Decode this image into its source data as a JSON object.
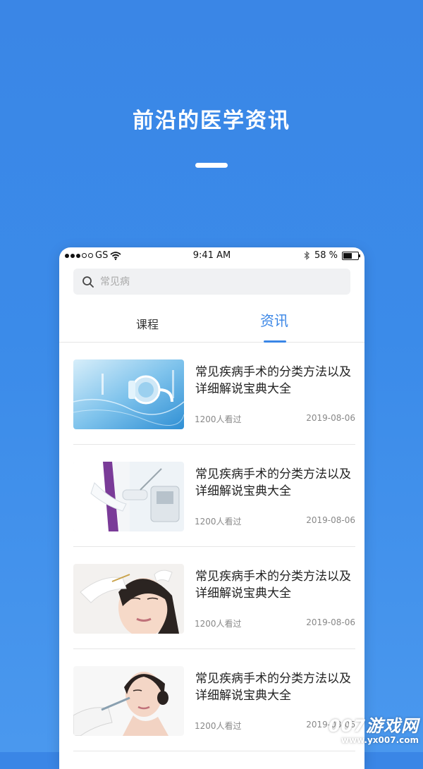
{
  "promo": {
    "title": "前沿的医学资讯"
  },
  "status_bar": {
    "carrier": "GS",
    "time": "9:41 AM",
    "battery": "58 %",
    "battery_level": 0.58
  },
  "search": {
    "placeholder": "常见病"
  },
  "tabs": [
    {
      "label": "课程",
      "active": false
    },
    {
      "label": "资讯",
      "active": true
    }
  ],
  "articles": [
    {
      "title": "常见疾病手术的分类方法以及详细解说宝典大全",
      "views": "1200人看过",
      "date": "2019-08-06",
      "image": "stethoscope"
    },
    {
      "title": "常见疾病手术的分类方法以及详细解说宝典大全",
      "views": "1200人看过",
      "date": "2019-08-06",
      "image": "doctor-with-device"
    },
    {
      "title": "常见疾病手术的分类方法以及详细解说宝典大全",
      "views": "1200人看过",
      "date": "2019-08-06",
      "image": "facial-treatment"
    },
    {
      "title": "常见疾病手术的分类方法以及详细解说宝典大全",
      "views": "1200人看过",
      "date": "2019-08-06",
      "image": "cosmetic-injection"
    }
  ],
  "watermark": {
    "brand": "007游戏网",
    "url": "www.yx007.com"
  },
  "colors": {
    "accent": "#3a86e6",
    "background": "#3b8be9"
  }
}
